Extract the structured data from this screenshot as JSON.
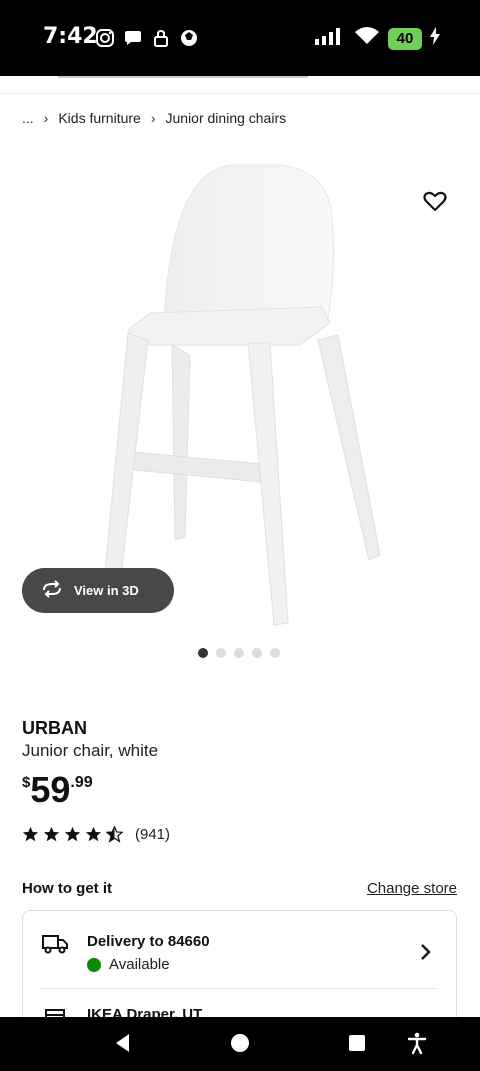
{
  "status_bar": {
    "time": "7:42",
    "battery": "40"
  },
  "breadcrumb": {
    "ellipsis": "...",
    "items": [
      "Kids furniture",
      "Junior dining chairs"
    ]
  },
  "product": {
    "view_3d_label": "View in 3D",
    "name": "URBAN",
    "description": "Junior chair, white",
    "price_currency": "$",
    "price_whole": "59",
    "price_decimal": ".99",
    "rating_stars": 4.5,
    "rating_count": "(941)",
    "image_count": 5,
    "image_index": 1
  },
  "delivery": {
    "section_title": "How to get it",
    "change_store_label": "Change store",
    "delivery_title": "Delivery to 84660",
    "delivery_status": "Available",
    "store_name": "IKEA Draper, UT"
  },
  "colors": {
    "accent_green": "#0a8a00",
    "view3d_bg": "#484848",
    "battery": "#6fcf58"
  }
}
